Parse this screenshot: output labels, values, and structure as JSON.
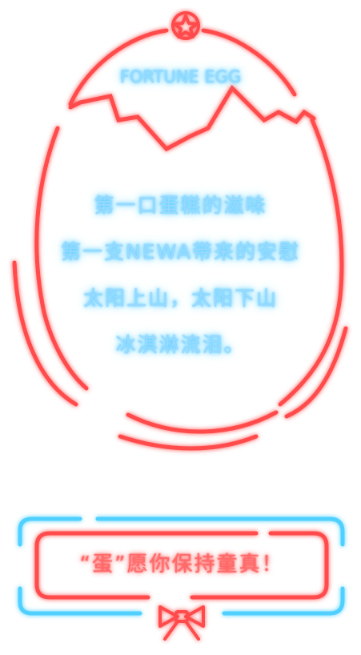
{
  "egg": {
    "title": "FORTUNE EGG",
    "poem": [
      "第一口蛋糕的滋味",
      "第一支NEWA带来的安慰",
      "太阳上山，太阳下山",
      "冰淇淋流泪。"
    ]
  },
  "banner": {
    "message": "“蛋”愿你保持童真！"
  },
  "icons": {
    "top": "star-icon",
    "bottom": "bow-icon"
  },
  "colors": {
    "red_neon": "#ff3b3b",
    "blue_neon": "#4fd0ff",
    "text_blue": "#9ad8ff",
    "background": "#ffffff"
  }
}
